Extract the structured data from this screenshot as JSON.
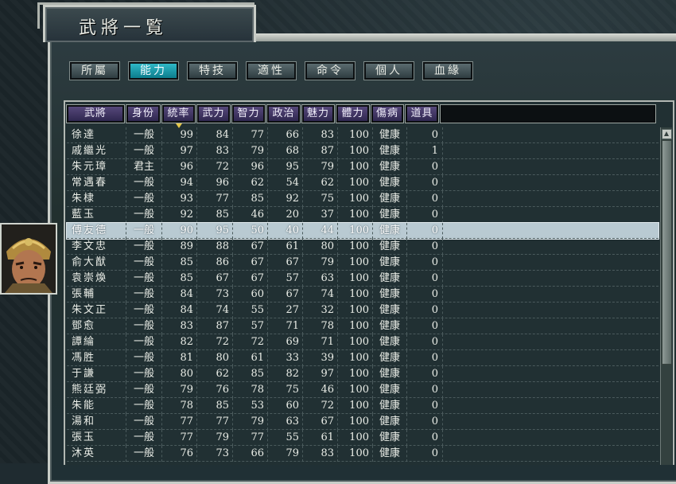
{
  "window": {
    "title": "武將一覧"
  },
  "tabs": [
    {
      "label": "所屬",
      "active": false
    },
    {
      "label": "能力",
      "active": true
    },
    {
      "label": "特技",
      "active": false
    },
    {
      "label": "適性",
      "active": false
    },
    {
      "label": "命令",
      "active": false
    },
    {
      "label": "個人",
      "active": false
    },
    {
      "label": "血緣",
      "active": false
    }
  ],
  "table": {
    "columns": [
      "武將",
      "身份",
      "統率",
      "武力",
      "智力",
      "政治",
      "魅力",
      "體力",
      "傷病",
      "道具"
    ],
    "sorted_column": "統率",
    "selected_row_index": 6,
    "rows": [
      {
        "name": "徐達",
        "rank": "一般",
        "lead": "99",
        "war": "84",
        "int": "77",
        "pol": "66",
        "cha": "83",
        "hp": "100",
        "status": "健康",
        "items": "0"
      },
      {
        "name": "戚繼光",
        "rank": "一般",
        "lead": "97",
        "war": "83",
        "int": "79",
        "pol": "68",
        "cha": "87",
        "hp": "100",
        "status": "健康",
        "items": "1"
      },
      {
        "name": "朱元璋",
        "rank": "君主",
        "lead": "96",
        "war": "72",
        "int": "96",
        "pol": "95",
        "cha": "79",
        "hp": "100",
        "status": "健康",
        "items": "0"
      },
      {
        "name": "常遇春",
        "rank": "一般",
        "lead": "94",
        "war": "96",
        "int": "62",
        "pol": "54",
        "cha": "62",
        "hp": "100",
        "status": "健康",
        "items": "0"
      },
      {
        "name": "朱棣",
        "rank": "一般",
        "lead": "93",
        "war": "77",
        "int": "85",
        "pol": "92",
        "cha": "75",
        "hp": "100",
        "status": "健康",
        "items": "0"
      },
      {
        "name": "藍玉",
        "rank": "一般",
        "lead": "92",
        "war": "85",
        "int": "46",
        "pol": "20",
        "cha": "37",
        "hp": "100",
        "status": "健康",
        "items": "0"
      },
      {
        "name": "傅友德",
        "rank": "一般",
        "lead": "90",
        "war": "95",
        "int": "50",
        "pol": "40",
        "cha": "44",
        "hp": "100",
        "status": "健康",
        "items": "0"
      },
      {
        "name": "李文忠",
        "rank": "一般",
        "lead": "89",
        "war": "88",
        "int": "67",
        "pol": "61",
        "cha": "80",
        "hp": "100",
        "status": "健康",
        "items": "0"
      },
      {
        "name": "俞大猷",
        "rank": "一般",
        "lead": "85",
        "war": "86",
        "int": "67",
        "pol": "67",
        "cha": "79",
        "hp": "100",
        "status": "健康",
        "items": "0"
      },
      {
        "name": "袁崇煥",
        "rank": "一般",
        "lead": "85",
        "war": "67",
        "int": "67",
        "pol": "57",
        "cha": "63",
        "hp": "100",
        "status": "健康",
        "items": "0"
      },
      {
        "name": "張輔",
        "rank": "一般",
        "lead": "84",
        "war": "73",
        "int": "60",
        "pol": "67",
        "cha": "74",
        "hp": "100",
        "status": "健康",
        "items": "0"
      },
      {
        "name": "朱文正",
        "rank": "一般",
        "lead": "84",
        "war": "74",
        "int": "55",
        "pol": "27",
        "cha": "32",
        "hp": "100",
        "status": "健康",
        "items": "0"
      },
      {
        "name": "鄧愈",
        "rank": "一般",
        "lead": "83",
        "war": "87",
        "int": "57",
        "pol": "71",
        "cha": "78",
        "hp": "100",
        "status": "健康",
        "items": "0"
      },
      {
        "name": "譚綸",
        "rank": "一般",
        "lead": "82",
        "war": "72",
        "int": "72",
        "pol": "69",
        "cha": "71",
        "hp": "100",
        "status": "健康",
        "items": "0"
      },
      {
        "name": "馮胜",
        "rank": "一般",
        "lead": "81",
        "war": "80",
        "int": "61",
        "pol": "33",
        "cha": "39",
        "hp": "100",
        "status": "健康",
        "items": "0"
      },
      {
        "name": "于謙",
        "rank": "一般",
        "lead": "80",
        "war": "62",
        "int": "85",
        "pol": "82",
        "cha": "97",
        "hp": "100",
        "status": "健康",
        "items": "0"
      },
      {
        "name": "熊廷弼",
        "rank": "一般",
        "lead": "79",
        "war": "76",
        "int": "78",
        "pol": "75",
        "cha": "46",
        "hp": "100",
        "status": "健康",
        "items": "0"
      },
      {
        "name": "朱能",
        "rank": "一般",
        "lead": "78",
        "war": "85",
        "int": "53",
        "pol": "60",
        "cha": "72",
        "hp": "100",
        "status": "健康",
        "items": "0"
      },
      {
        "name": "湯和",
        "rank": "一般",
        "lead": "77",
        "war": "77",
        "int": "79",
        "pol": "63",
        "cha": "67",
        "hp": "100",
        "status": "健康",
        "items": "0"
      },
      {
        "name": "張玉",
        "rank": "一般",
        "lead": "77",
        "war": "79",
        "int": "77",
        "pol": "55",
        "cha": "61",
        "hp": "100",
        "status": "健康",
        "items": "0"
      },
      {
        "name": "沐英",
        "rank": "一般",
        "lead": "76",
        "war": "73",
        "int": "66",
        "pol": "79",
        "cha": "83",
        "hp": "100",
        "status": "健康",
        "items": "0"
      }
    ]
  },
  "icons": {
    "sort_indicator": "sort-desc-icon",
    "scroll_up": "scroll-up-icon"
  },
  "colors": {
    "tab_active": "#1a9aa9",
    "header_bg": "#3f3561",
    "selected_row": "#b9cad2"
  }
}
